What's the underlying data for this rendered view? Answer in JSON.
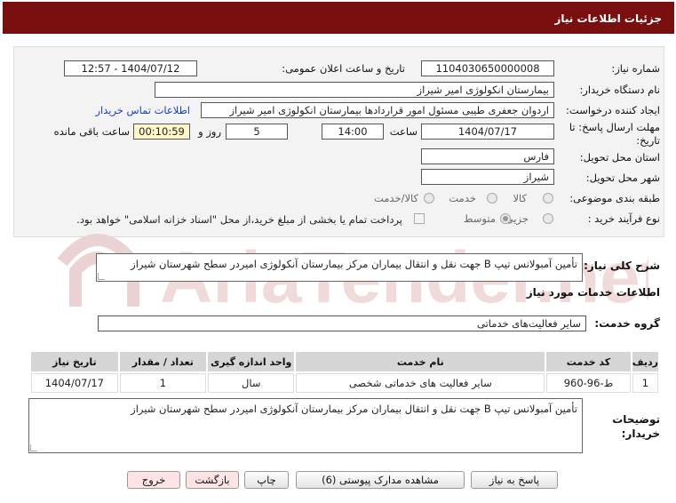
{
  "header": {
    "title": "جزئیات اطلاعات نیاز"
  },
  "form": {
    "need_number": {
      "label": "شماره نیاز:",
      "value": "1104030650000008"
    },
    "announce": {
      "label": "تاریخ و ساعت اعلان عمومی:",
      "value": "1404/07/12 - 12:57"
    },
    "buyer_org": {
      "label": "نام دستگاه خریدار:",
      "value": "بیمارستان انکولوژی امیر شیراز"
    },
    "creator": {
      "label": "ایجاد کننده درخواست:",
      "value": "اردوان جعفری طیبی مسئول امور قراردادها بیمارستان انکولوژی امیر شیراز",
      "contact_link": "اطلاعات تماس خریدار"
    },
    "deadline": {
      "label_line1": "مهلت ارسال پاسخ: تا",
      "label_line2": "تاریخ:",
      "date": "1404/07/17",
      "time_label": "ساعت",
      "time": "14:00",
      "days_value": "5",
      "days_label": "روز و",
      "remaining": "00:10:59",
      "remaining_label": "ساعت باقی مانده"
    },
    "province": {
      "label": "استان محل تحویل:",
      "value": "فارس"
    },
    "city": {
      "label": "شهر محل تحویل:",
      "value": "شیراز"
    },
    "category": {
      "label": "طبقه بندی موضوعی:",
      "options": [
        "کالا",
        "خدمت",
        "کالا/خدمت"
      ],
      "selected": "خدمت"
    },
    "purchase_type": {
      "label": "نوع فرآیند خرید :",
      "options": [
        "جزیی",
        "متوسط"
      ],
      "selected": "متوسط",
      "payment_note": "پرداخت تمام یا بخشی از مبلغ خرید،از محل \"اسناد خزانه اسلامی\" خواهد بود."
    }
  },
  "summary": {
    "label": "شرح کلی نیاز:",
    "value": "تأمین آمبولانس تیپ B جهت نقل و انتقال بیماران مرکز بیمارستان آنکولوژی امیردر سطح شهرستان شیراز"
  },
  "services_section": {
    "title": "اطلاعات خدمات مورد نیاز"
  },
  "service_group": {
    "label": "گروه خدمت:",
    "value": "سایر فعالیت‌های خدماتی"
  },
  "table": {
    "headers": [
      "ردیف",
      "کد خدمت",
      "نام خدمت",
      "واحد اندازه گیری",
      "تعداد / مقدار",
      "تاریخ نیاز"
    ],
    "rows": [
      [
        "1",
        "ط-96-960",
        "سایر فعالیت های خدماتی شخصی",
        "سال",
        "1",
        "1404/07/17"
      ]
    ]
  },
  "buyer_notes": {
    "label_line1": "توضیحات",
    "label_line2": "خریدار:",
    "value": "تأمین آمبولانس تیپ B جهت نقل و انتقال بیماران مرکز بیمارستان آنکولوژی امیردر سطح شهرستان شیراز"
  },
  "buttons": {
    "reply": "پاسخ به نیاز",
    "attachments": "مشاهده مدارک پیوستی (6)",
    "print": "چاپ",
    "back": "بازگشت",
    "exit": "خروج"
  },
  "watermark": {
    "text": "AriaTender.net",
    "color": "#e9caca"
  },
  "colors": {
    "header": "#7a0f0f",
    "remaining_bg": "#fff7c9",
    "link": "#1a3fb8"
  }
}
